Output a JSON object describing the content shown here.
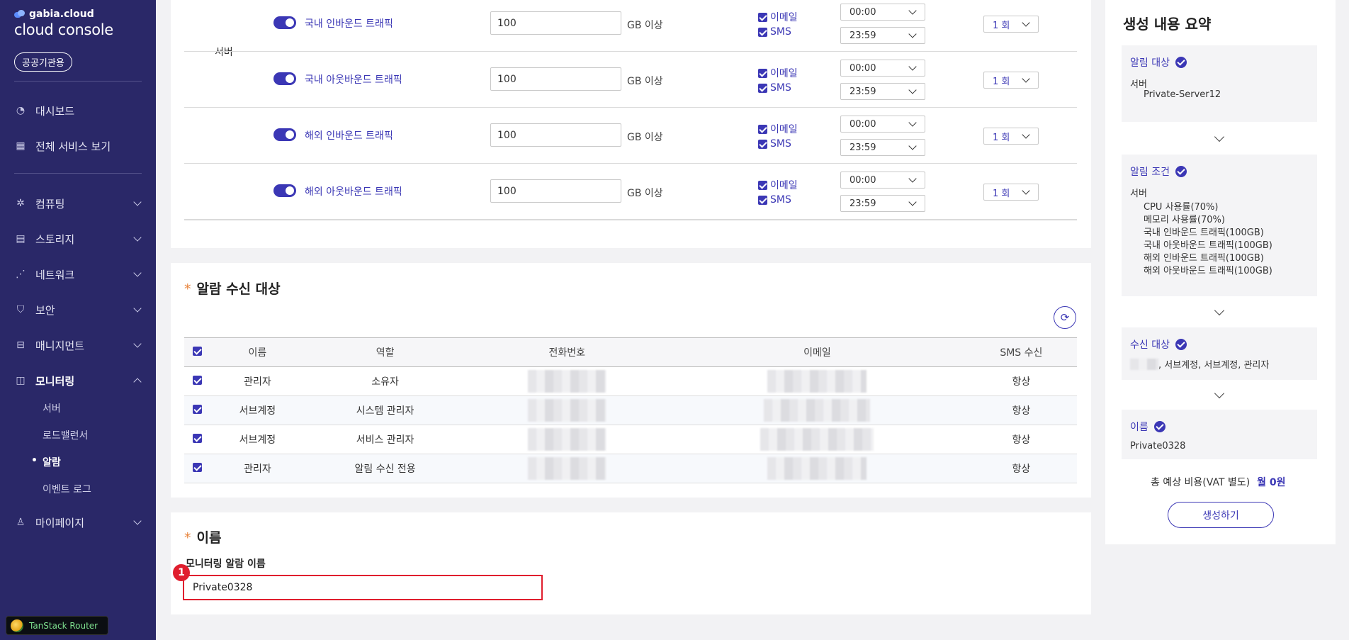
{
  "sidebar": {
    "brand_small": "gabia.cloud",
    "brand_big": "cloud console",
    "badge": "공공기관용",
    "items": [
      {
        "label": "대시보드"
      },
      {
        "label": "전체 서비스 보기"
      },
      {
        "label": "컴퓨팅"
      },
      {
        "label": "스토리지"
      },
      {
        "label": "네트워크"
      },
      {
        "label": "보안"
      },
      {
        "label": "매니지먼트"
      },
      {
        "label": "모니터링"
      },
      {
        "label": "마이페이지"
      }
    ],
    "monitoring_sub": [
      {
        "label": "서버"
      },
      {
        "label": "로드밸런서"
      },
      {
        "label": "알람"
      },
      {
        "label": "이벤트 로그"
      }
    ],
    "devtools_label": "TanStack Router"
  },
  "conditions": {
    "group_label": "서버",
    "rows": [
      {
        "metric": "국내 인바운드 트래픽",
        "value": "100",
        "unit": "GB 이상",
        "email": "이메일",
        "sms": "SMS",
        "start": "00:00",
        "end": "23:59",
        "count": "1 회"
      },
      {
        "metric": "국내 아웃바운드 트래픽",
        "value": "100",
        "unit": "GB 이상",
        "email": "이메일",
        "sms": "SMS",
        "start": "00:00",
        "end": "23:59",
        "count": "1 회"
      },
      {
        "metric": "해외 인바운드 트래픽",
        "value": "100",
        "unit": "GB 이상",
        "email": "이메일",
        "sms": "SMS",
        "start": "00:00",
        "end": "23:59",
        "count": "1 회"
      },
      {
        "metric": "해외 아웃바운드 트래픽",
        "value": "100",
        "unit": "GB 이상",
        "email": "이메일",
        "sms": "SMS",
        "start": "00:00",
        "end": "23:59",
        "count": "1 회"
      }
    ]
  },
  "recipients": {
    "title": "알람 수신 대상",
    "columns": [
      "이름",
      "역할",
      "전화번호",
      "이메일",
      "SMS 수신"
    ],
    "rows": [
      {
        "name": "관리자",
        "role": "소유자",
        "sms": "항상"
      },
      {
        "name": "서브계정",
        "role": "시스템 관리자",
        "sms": "항상"
      },
      {
        "name": "서브계정",
        "role": "서비스 관리자",
        "sms": "항상"
      },
      {
        "name": "관리자",
        "role": "알림 수신 전용",
        "sms": "항상"
      }
    ]
  },
  "name_section": {
    "title": "이름",
    "field_label": "모니터링 알람 이름",
    "value": "Private0328",
    "annotation": "1"
  },
  "summary": {
    "title": "생성 내용 요약",
    "target": {
      "head": "알림 대상",
      "type": "서버",
      "item": "Private-Server12"
    },
    "condition": {
      "head": "알림 조건",
      "type": "서버",
      "items": [
        "CPU 사용률(70%)",
        "메모리 사용률(70%)",
        "국내 인바운드 트래픽(100GB)",
        "국내 아웃바운드 트래픽(100GB)",
        "해외 인바운드 트래픽(100GB)",
        "해외 아웃바운드 트래픽(100GB)"
      ]
    },
    "receivers": {
      "head": "수신 대상",
      "text": ", 서브계정, 서브계정, 관리자"
    },
    "name": {
      "head": "이름",
      "value": "Private0328"
    },
    "cost_label": "총 예상 비용(VAT 별도)",
    "cost_value": "월 0원",
    "create_label": "생성하기"
  },
  "colors": {
    "accent": "#3b37b5",
    "sidebar_bg": "#2a2868",
    "highlight": "#e01e2e"
  },
  "icons": [
    "dashboard-icon",
    "grid-icon",
    "chip-icon",
    "storage-icon",
    "network-icon",
    "shield-icon",
    "management-icon",
    "monitor-icon",
    "user-icon",
    "refresh-icon",
    "check-icon"
  ]
}
